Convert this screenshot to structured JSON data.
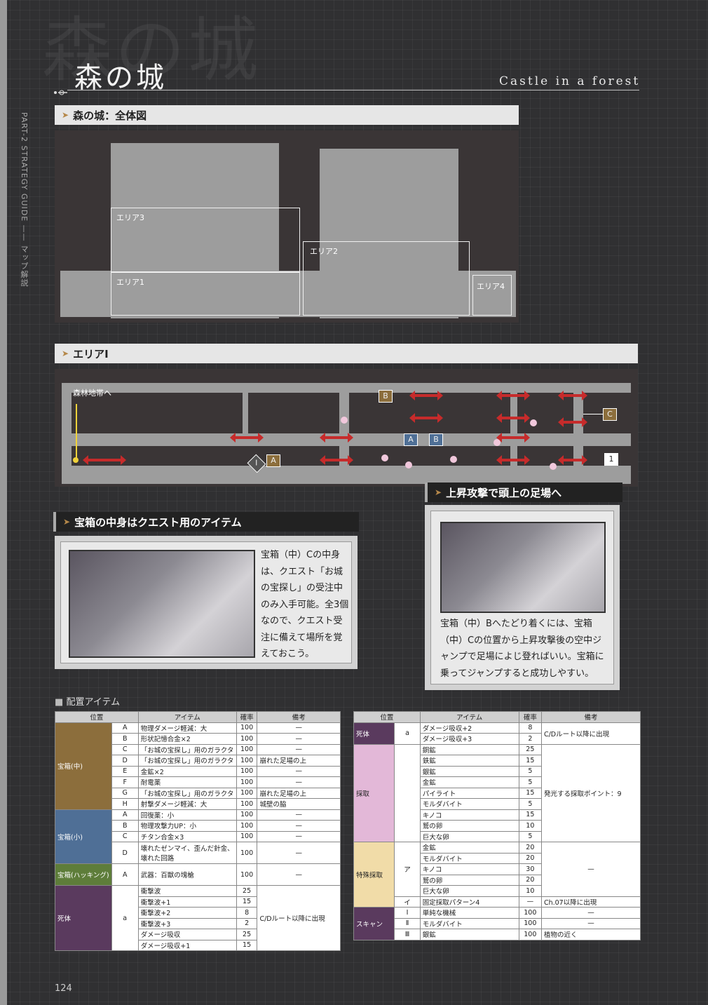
{
  "page": {
    "watermark": "森の城",
    "title": "森の城",
    "subtitle": "Castle in a forest",
    "side_label": "PART-2 STRATEGY GUIDE —— マップ解説",
    "page_number": "124"
  },
  "sections": {
    "overview": "森の城：全体図",
    "area1": "エリアⅠ",
    "chest": "宝箱の中身はクエスト用のアイテム",
    "jump": "上昇攻撃で頭上の足場へ",
    "items": "配置アイテム"
  },
  "overview_map": {
    "labels": [
      "エリア3",
      "エリア1",
      "エリア2",
      "エリア4"
    ]
  },
  "area1_map": {
    "forest_label": "森林地帯へ",
    "markers": [
      "A",
      "B",
      "A",
      "B",
      "C",
      "1",
      "Ⅰ"
    ]
  },
  "chest_panel": {
    "text": "宝箱（中）Cの中身は、クエスト「お城の宝探し」の受注中のみ入手可能。全3個なので、クエスト受注に備えて場所を覚えておこう。"
  },
  "jump_panel": {
    "text": "宝箱（中）Bへたどり着くには、宝箱（中）Cの位置から上昇攻撃後の空中ジャンプで足場によじ登ればいい。宝箱に乗ってジャンプすると成功しやすい。"
  },
  "table_headers": [
    "位置",
    "アイテム",
    "確率",
    "備考"
  ],
  "colors": {
    "chest_mid": "#8c6e3c",
    "chest_small": "#4f6f96",
    "chest_hack": "#5e7d3a",
    "corpse": "#5a3a5e",
    "mining": "#e3b8d8",
    "special": "#f1dca8",
    "scan": "#5a3a5e",
    "arrow": "#c62b2b"
  },
  "left_table": [
    {
      "cat": "宝箱(中)",
      "cat_rows": 8,
      "color": "#8c6e3c",
      "sub": "A",
      "item": "物理ダメージ軽減：大",
      "rate": "100",
      "note": "—"
    },
    {
      "sub": "B",
      "item": "形状記憶合金×2",
      "rate": "100",
      "note": "—"
    },
    {
      "sub": "C",
      "item": "「お城の宝探し」用のガラクタ",
      "rate": "100",
      "note": "—"
    },
    {
      "sub": "D",
      "item": "「お城の宝探し」用のガラクタ",
      "rate": "100",
      "note": "崩れた足場の上"
    },
    {
      "sub": "E",
      "item": "金鉱×2",
      "rate": "100",
      "note": "—"
    },
    {
      "sub": "F",
      "item": "耐電薬",
      "rate": "100",
      "note": "—"
    },
    {
      "sub": "G",
      "item": "「お城の宝探し」用のガラクタ",
      "rate": "100",
      "note": "崩れた足場の上"
    },
    {
      "sub": "H",
      "item": "射撃ダメージ軽減：大",
      "rate": "100",
      "note": "城壁の脇"
    },
    {
      "cat": "宝箱(小)",
      "cat_rows": 4,
      "color": "#4f6f96",
      "sub": "A",
      "item": "回復薬：小",
      "rate": "100",
      "note": "—"
    },
    {
      "sub": "B",
      "item": "物理攻撃力UP：小",
      "rate": "100",
      "note": "—"
    },
    {
      "sub": "C",
      "item": "チタン合金×3",
      "rate": "100",
      "note": "—"
    },
    {
      "sub": "D",
      "item": "壊れたゼンマイ、歪んだ針金、壊れた回路",
      "rate": "100",
      "note": "—",
      "tall": true
    },
    {
      "cat": "宝箱(ハッキング)",
      "cat_rows": 1,
      "color": "#5e7d3a",
      "sub": "A",
      "item": "武器：百獣の塊槍",
      "rate": "100",
      "note": "—",
      "tall": true
    },
    {
      "cat": "死体",
      "cat_rows": 6,
      "color": "#5a3a5e",
      "sub": "a",
      "sub_rows": 6,
      "item": "衝撃波",
      "rate": "25",
      "note": "C/Dルート以降に出現",
      "note_rows": 6
    },
    {
      "item": "衝撃波+1",
      "rate": "15"
    },
    {
      "item": "衝撃波+2",
      "rate": "8"
    },
    {
      "item": "衝撃波+3",
      "rate": "2"
    },
    {
      "item": "ダメージ吸収",
      "rate": "25"
    },
    {
      "item": "ダメージ吸収+1",
      "rate": "15"
    }
  ],
  "right_table": [
    {
      "cat": "死体",
      "cat_rows": 2,
      "color": "#5a3a5e",
      "sub": "a",
      "sub_rows": 2,
      "item": "ダメージ吸収+2",
      "rate": "8",
      "note": "C/Dルート以降に出現",
      "note_rows": 2
    },
    {
      "item": "ダメージ吸収+3",
      "rate": "2"
    },
    {
      "cat": "採取",
      "cat_rows": 9,
      "color": "#e3b8d8",
      "sub": "",
      "sub_rows": 9,
      "item": "銅鉱",
      "rate": "25",
      "note": "発光する採取ポイント：9",
      "note_rows": 9
    },
    {
      "item": "鉄鉱",
      "rate": "15"
    },
    {
      "item": "銀鉱",
      "rate": "5"
    },
    {
      "item": "金鉱",
      "rate": "5"
    },
    {
      "item": "パイライト",
      "rate": "15"
    },
    {
      "item": "モルダバイト",
      "rate": "5"
    },
    {
      "item": "キノコ",
      "rate": "15"
    },
    {
      "item": "鷲の卵",
      "rate": "10"
    },
    {
      "item": "巨大な卵",
      "rate": "5"
    },
    {
      "cat": "特殊採取",
      "cat_rows": 6,
      "color": "#f1dca8",
      "sub": "ア",
      "sub_rows": 5,
      "item": "金鉱",
      "rate": "20",
      "note": "—",
      "note_rows": 5
    },
    {
      "item": "モルダバイト",
      "rate": "20"
    },
    {
      "item": "キノコ",
      "rate": "30"
    },
    {
      "item": "鷲の卵",
      "rate": "20"
    },
    {
      "item": "巨大な卵",
      "rate": "10"
    },
    {
      "sub": "イ",
      "item": "固定採取パターン4",
      "rate": "—",
      "note": "Ch.07以降に出現"
    },
    {
      "cat": "スキャン",
      "cat_rows": 3,
      "color": "#5a3a5e",
      "sub": "Ⅰ",
      "item": "単純な機械",
      "rate": "100",
      "note": "—"
    },
    {
      "sub": "Ⅱ",
      "item": "モルダバイト",
      "rate": "100",
      "note": "—"
    },
    {
      "sub": "Ⅲ",
      "item": "銀鉱",
      "rate": "100",
      "note": "植物の近く"
    }
  ]
}
